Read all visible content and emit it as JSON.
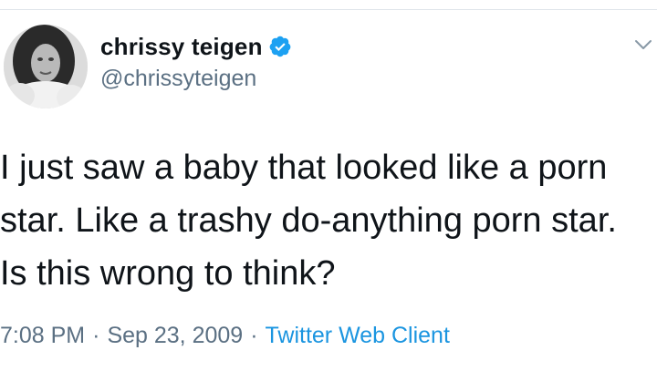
{
  "tweet": {
    "display_name": "chrissy teigen",
    "handle": "@chrissyteigen",
    "text": "I just saw a baby that looked like a porn star. Like a trashy do-anything porn star. Is this wrong to think?",
    "time": "7:08 PM",
    "date": "Sep 23, 2009",
    "separator": "·",
    "source": "Twitter Web Client"
  },
  "icons": {
    "verified": "verified-badge-icon",
    "menu": "chevron-down-icon"
  },
  "colors": {
    "verified_blue": "#1da1f2",
    "link_blue": "#1b95e0",
    "secondary_text": "#5b7083",
    "primary_text": "#0f1419"
  }
}
